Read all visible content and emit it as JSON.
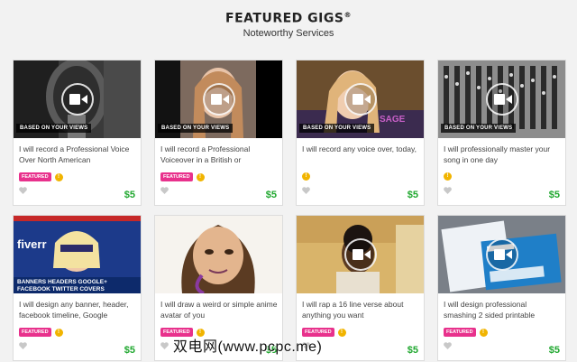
{
  "header": {
    "title": "FEATURED GIGS",
    "title_mark": "®",
    "subtitle": "Noteworthy Services"
  },
  "based_label": "BASED ON YOUR VIEWS",
  "featured_label": "FEATURED",
  "colors": {
    "featured_badge": "#e8318c",
    "price": "#21a830",
    "level_badge": "#f1b400"
  },
  "cards": [
    {
      "desc": "I will record a Professional Voice Over North American",
      "price": "$5",
      "based": true,
      "featured": true,
      "level": "!",
      "heart": "heart-icon",
      "thumb": "microphone-studio"
    },
    {
      "desc": "I will record a Professional Voiceover in a British or",
      "price": "$5",
      "based": true,
      "featured": true,
      "level": "!",
      "thumb": "woman-portrait"
    },
    {
      "desc": "I will record any voice over, today,",
      "price": "$5",
      "based": true,
      "featured": false,
      "level": "!",
      "thumb": "girl-sage"
    },
    {
      "desc": "I will professionally master your song in one day",
      "price": "$5",
      "based": true,
      "featured": false,
      "level": "!",
      "thumb": "mixing-console"
    },
    {
      "desc": "I will design any banner, header, facebook timeline, Google",
      "price": "$5",
      "based": false,
      "featured": true,
      "level": "!",
      "thumb": "fiverr-banner",
      "thumb_text": [
        "fiverr",
        "BANNERS HEADERS GOOGLE+",
        "FACEBOOK TWITTER COVERS"
      ]
    },
    {
      "desc": "I will draw a weird or simple anime avatar of you",
      "price": "$5",
      "based": false,
      "featured": true,
      "level": "!",
      "thumb": "anime-drawing"
    },
    {
      "desc": "I will rap a 16 line verse about anything you want",
      "price": "$5",
      "based": false,
      "featured": true,
      "level": "!",
      "thumb": "rapper"
    },
    {
      "desc": "I will design professional smashing 2 sided printable",
      "price": "$5",
      "based": false,
      "featured": true,
      "level": "!",
      "thumb": "business-cards"
    }
  ],
  "watermark": "双电网(www.pcpc.me)"
}
